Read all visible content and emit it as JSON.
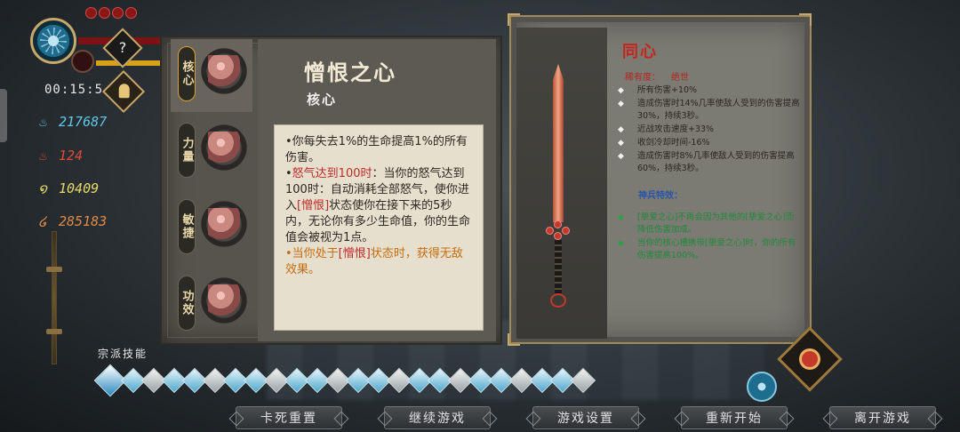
{
  "hud": {
    "timer": "00:15:5",
    "help_symbol": "?",
    "stats": [
      {
        "icon": "flame-blue-icon",
        "value": "217687",
        "color": "#5ec9e8"
      },
      {
        "icon": "flame-red-icon",
        "value": "124",
        "color": "#e04a3a"
      },
      {
        "icon": "swirl-yellow-icon",
        "value": "10409",
        "color": "#e8d86a"
      },
      {
        "icon": "spiral-orange-icon",
        "value": "285183",
        "color": "#e08a4a"
      }
    ]
  },
  "core_slots": [
    {
      "label": "核心",
      "selected": true
    },
    {
      "label": "力量",
      "selected": false
    },
    {
      "label": "敏捷",
      "selected": false
    },
    {
      "label": "功效",
      "selected": false
    }
  ],
  "core_detail": {
    "title": "憎恨之心",
    "subtitle": "核心",
    "line1": "•你每失去1%的生命提高1%的所有伤害。",
    "line2_prefix": "•",
    "line2_red": "怒气达到100时",
    "line2_text_a": "：当你的怒气达到100时：自动消耗全部怒气，使你进入",
    "line2_bracket": "[憎恨]",
    "line2_text_b": "状态使你在接下来的5秒内，无论你有多少生命值，你的生命值会被视为1点。",
    "line3_a": "•当你处于",
    "line3_bracket": "[憎恨]",
    "line3_b": "状态时，获得无敌效果。"
  },
  "weapon": {
    "name": "同心",
    "rarity_label": "稀有度：",
    "rarity_value": "绝世",
    "bullet_symbol": "◆",
    "effects": [
      "所有伤害+10%",
      "造成伤害时14%几率使敌人受到的伤害提高30%，持续3秒。",
      "近战攻击速度+33%",
      "收剑冷却时间-16%",
      "造成伤害时8%几率使敌人受到的伤害提高60%，持续3秒。"
    ],
    "special_title": "神兵特效：",
    "special_effects": [
      "[挚爱之心]不再会因为其他的[挚爱之心]而降低伤害加成。",
      "当你的核心槽携带[挚爱之心]时，你的所有伤害提高100%。"
    ]
  },
  "skills": {
    "label": "宗派技能",
    "count": 24
  },
  "menu_buttons": [
    "卡死重置",
    "继续游戏",
    "游戏设置",
    "重新开始",
    "离开游戏"
  ]
}
